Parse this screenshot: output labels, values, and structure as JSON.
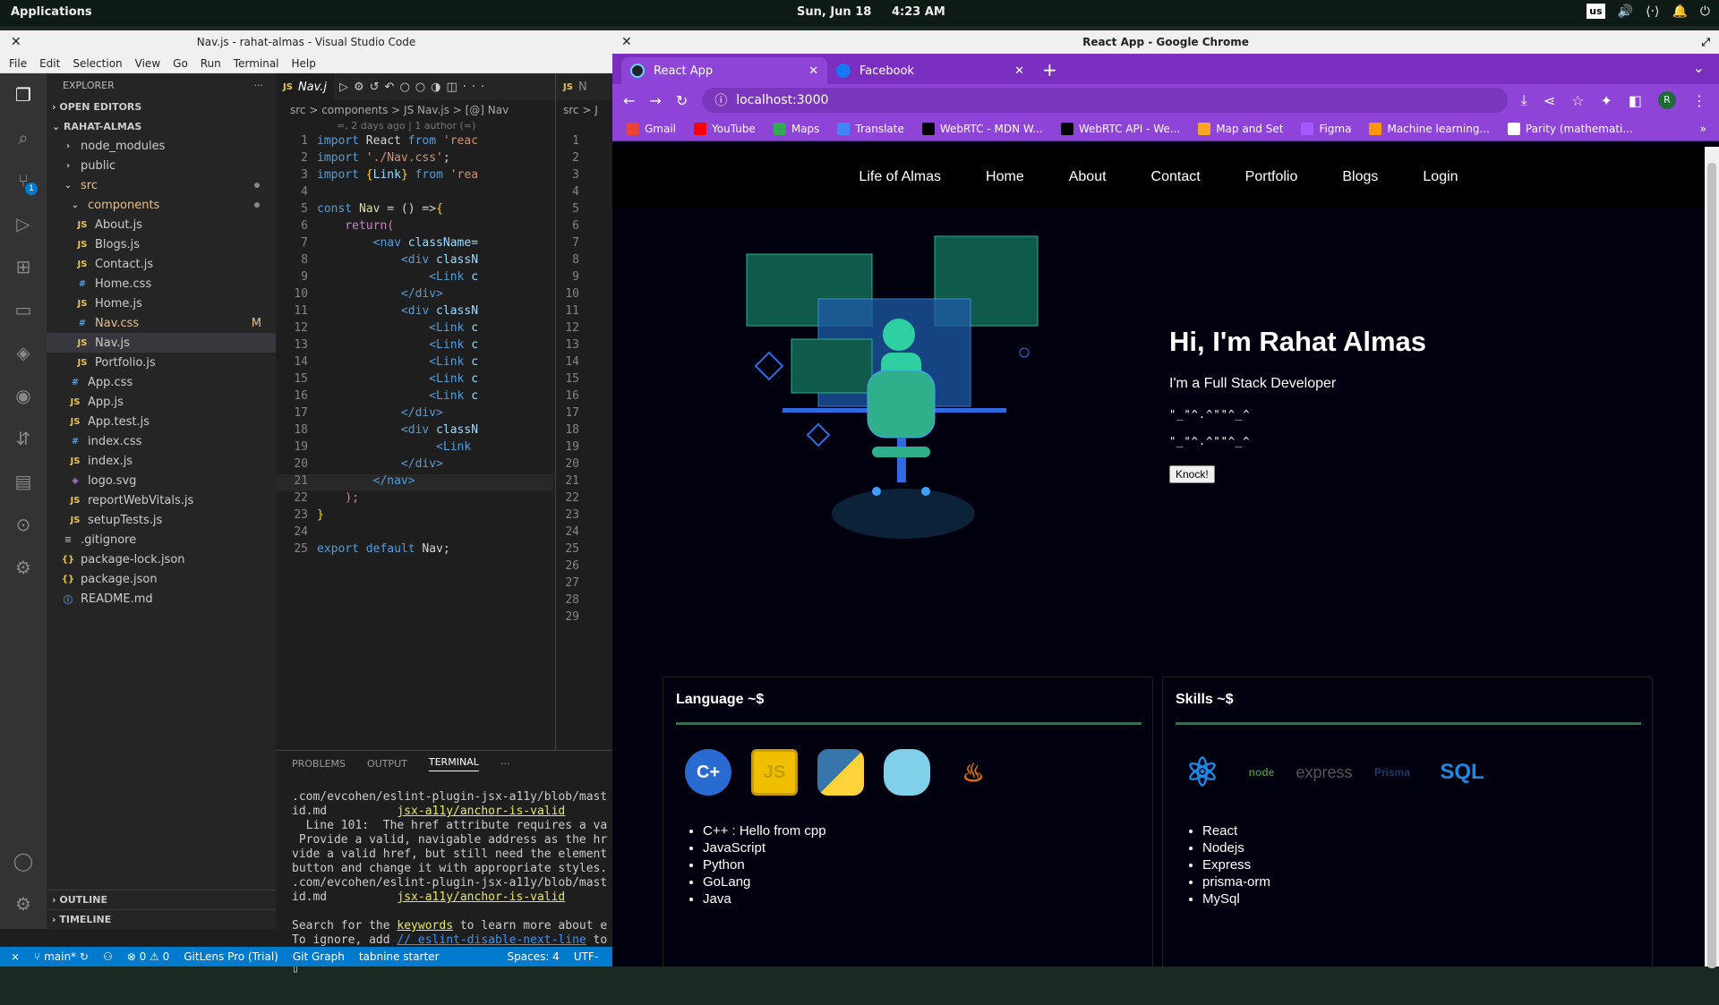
{
  "topbar": {
    "applications": "Applications",
    "date": "Sun, Jun 18",
    "time": "4:23 AM",
    "keyboard": "us"
  },
  "vscode": {
    "title": "Nav.js - rahat-almas - Visual Studio Code",
    "menu": [
      "File",
      "Edit",
      "Selection",
      "View",
      "Go",
      "Run",
      "Terminal",
      "Help"
    ],
    "explorer_label": "EXPLORER",
    "open_editors": "OPEN EDITORS",
    "project": "RAHAT-ALMAS",
    "tree": [
      {
        "name": "node_modules",
        "type": "folder",
        "depth": 1
      },
      {
        "name": "public",
        "type": "folder",
        "depth": 1
      },
      {
        "name": "src",
        "type": "folder-open",
        "depth": 1,
        "mod": true
      },
      {
        "name": "components",
        "type": "folder-open",
        "depth": 2,
        "mod": true
      },
      {
        "name": "About.js",
        "type": "js",
        "depth": 3
      },
      {
        "name": "Blogs.js",
        "type": "js",
        "depth": 3
      },
      {
        "name": "Contact.js",
        "type": "js",
        "depth": 3
      },
      {
        "name": "Home.css",
        "type": "css",
        "depth": 3
      },
      {
        "name": "Home.js",
        "type": "js",
        "depth": 3
      },
      {
        "name": "Nav.css",
        "type": "css",
        "depth": 3,
        "badge": "M"
      },
      {
        "name": "Nav.js",
        "type": "js",
        "depth": 3,
        "selected": true
      },
      {
        "name": "Portfolio.js",
        "type": "js",
        "depth": 3
      },
      {
        "name": "App.css",
        "type": "css",
        "depth": 2
      },
      {
        "name": "App.js",
        "type": "js",
        "depth": 2
      },
      {
        "name": "App.test.js",
        "type": "js",
        "depth": 2
      },
      {
        "name": "index.css",
        "type": "css",
        "depth": 2
      },
      {
        "name": "index.js",
        "type": "js",
        "depth": 2
      },
      {
        "name": "logo.svg",
        "type": "svg",
        "depth": 2
      },
      {
        "name": "reportWebVitals.js",
        "type": "js",
        "depth": 2
      },
      {
        "name": "setupTests.js",
        "type": "js",
        "depth": 2
      },
      {
        "name": ".gitignore",
        "type": "git",
        "depth": 1
      },
      {
        "name": "package-lock.json",
        "type": "json",
        "depth": 1
      },
      {
        "name": "package.json",
        "type": "json",
        "depth": 1
      },
      {
        "name": "README.md",
        "type": "md",
        "depth": 1
      }
    ],
    "outline": "OUTLINE",
    "timeline": "TIMELINE",
    "tab": "Nav.j",
    "tab2": "N",
    "breadcrumb": "src > components > JS Nav.js > [@] Nav",
    "breadcrumb2": "src > J",
    "blame": "=, 2 days ago | 1 author (=)",
    "panel_tabs": [
      "PROBLEMS",
      "OUTPUT",
      "TERMINAL"
    ],
    "terminal": {
      "l1": ".com/evcohen/eslint-plugin-jsx-a11y/blob/mast",
      "l2a": "id.md          ",
      "l2b": "jsx-a11y/anchor-is-valid",
      "l3": "  Line 101:  The href attribute requires a va",
      "l4": " Provide a valid, navigable address as the hr",
      "l5": "vide a valid href, but still need the element",
      "l6": "button and change it with appropriate styles.",
      "l7": ".com/evcohen/eslint-plugin-jsx-a11y/blob/mast",
      "l8a": "id.md          ",
      "l8b": "jsx-a11y/anchor-is-valid",
      "l9a": "Search for the ",
      "l9b": "keywords",
      "l9c": " to learn more about e",
      "l10a": "To ignore, add ",
      "l10b": "// eslint-disable-next-line",
      "l10c": " to"
    },
    "status": {
      "branch": "main*",
      "problems": "⊗ 0 ⚠ 0",
      "gitlens": "GitLens Pro (Trial)",
      "graph": "Git Graph",
      "tabnine": "tabnine starter",
      "spaces": "Spaces: 4",
      "enc": "UTF-"
    },
    "source_control_badge": "1"
  },
  "chrome": {
    "title": "React App - Google Chrome",
    "tabs": [
      {
        "title": "React App",
        "active": true
      },
      {
        "title": "Facebook",
        "active": false
      }
    ],
    "url": "localhost:3000",
    "avatar": "R",
    "bookmarks": [
      {
        "label": "Gmail",
        "color": "#ea4335"
      },
      {
        "label": "YouTube",
        "color": "#ff0000"
      },
      {
        "label": "Maps",
        "color": "#34a853"
      },
      {
        "label": "Translate",
        "color": "#4285f4"
      },
      {
        "label": "WebRTC - MDN W...",
        "color": "#000000"
      },
      {
        "label": "WebRTC API - We...",
        "color": "#000000"
      },
      {
        "label": "Map and Set",
        "color": "#f9a825"
      },
      {
        "label": "Figma",
        "color": "#a259ff"
      },
      {
        "label": "Machine learning...",
        "color": "#ff9800"
      },
      {
        "label": "Parity (mathemati...",
        "color": "#ffffff"
      }
    ]
  },
  "site": {
    "nav": [
      "Life of Almas",
      "Home",
      "About",
      "Contact",
      "Portfolio",
      "Blogs",
      "Login"
    ],
    "hero": {
      "title": "Hi, I'm Rahat Almas",
      "subtitle": "I'm a Full Stack Developer",
      "sym1": "\"_\"^.^\"\"^_^",
      "sym2": "\"_\"^.^\"\"^_^",
      "button": "Knock!"
    },
    "language_card": {
      "title": "Language ~$",
      "items": [
        "C++ : Hello from cpp",
        "JavaScript",
        "Python",
        "GoLang",
        "Java"
      ]
    },
    "skills_card": {
      "title": "Skills ~$",
      "items": [
        "React",
        "Nodejs",
        "Express",
        "prisma-orm",
        "MySql"
      ],
      "logos": {
        "express": "express",
        "prisma": "Prisma",
        "sql": "SQL"
      }
    }
  },
  "colors": {
    "chrome_purple": "#8e44d6",
    "accent_green": "#1e7c4c",
    "vscode_blue": "#007acc"
  }
}
